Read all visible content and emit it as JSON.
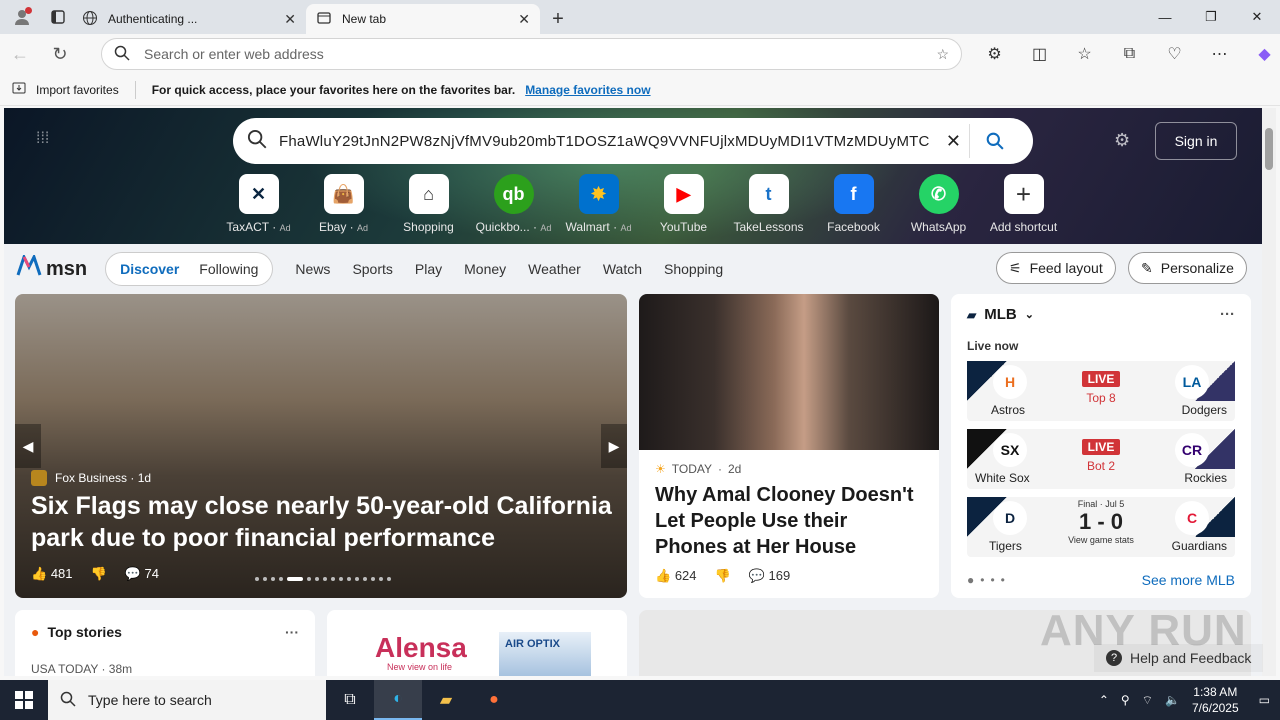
{
  "browser": {
    "tabs": [
      {
        "title": "Authenticating ...",
        "active": false
      },
      {
        "title": "New tab",
        "active": true
      }
    ],
    "address_placeholder": "Search or enter web address",
    "favbar": {
      "import_label": "Import favorites",
      "hint": "For quick access, place your favorites here on the favorites bar.",
      "manage_link": "Manage favorites now"
    }
  },
  "msn": {
    "search_query": "FhaWluY29tJnN2PW8zNjVfMV9ub20mbT1DOSZ1aWQ9VVNFUjlxMDUyMDI1VTMzMDUyMTC",
    "sign_in": "Sign in",
    "shortcuts": [
      {
        "label": "TaxACT",
        "ad": "Ad",
        "color": "#0a2540"
      },
      {
        "label": "Ebay",
        "ad": "Ad",
        "color": "#e53238"
      },
      {
        "label": "Shopping",
        "ad": "",
        "color": "#333"
      },
      {
        "label": "Quickbo...",
        "ad": "Ad",
        "color": "#2ca01c"
      },
      {
        "label": "Walmart",
        "ad": "Ad",
        "color": "#0071ce"
      },
      {
        "label": "YouTube",
        "ad": "",
        "color": "#ff0000"
      },
      {
        "label": "TakeLessons",
        "ad": "",
        "color": "#1a73c9"
      },
      {
        "label": "Facebook",
        "ad": "",
        "color": "#1877f2"
      },
      {
        "label": "WhatsApp",
        "ad": "",
        "color": "#25d366"
      },
      {
        "label": "Add shortcut",
        "ad": "",
        "color": "#555"
      }
    ],
    "logo": "msn",
    "pills": [
      "Discover",
      "Following"
    ],
    "nav": [
      "News",
      "Sports",
      "Play",
      "Money",
      "Weather",
      "Watch",
      "Shopping"
    ],
    "feed_layout": "Feed layout",
    "personalize": "Personalize"
  },
  "main_story": {
    "source": "Fox Business",
    "age": "1d",
    "headline": "Six Flags may close nearly 50-year-old California park due to poor financial performance",
    "likes": "481",
    "comments": "74"
  },
  "side_story": {
    "source": "TODAY",
    "age": "2d",
    "headline": "Why Amal Clooney Doesn't Let People Use their Phones at Her House",
    "likes": "624",
    "comments": "169"
  },
  "mlb": {
    "title": "MLB",
    "live_now": "Live now",
    "games": [
      {
        "home": "Astros",
        "away": "Dodgers",
        "tag": "LIVE",
        "status": "Top 8",
        "hl": "H",
        "al": "LA"
      },
      {
        "home": "White Sox",
        "away": "Rockies",
        "tag": "LIVE",
        "status": "Bot 2",
        "hl": "SX",
        "al": "CR"
      },
      {
        "home": "Tigers",
        "away": "Guardians",
        "final": "Final · Jul 5",
        "score": "1 - 0",
        "view": "View game stats",
        "hl": "D",
        "al": "C"
      }
    ],
    "see_more": "See more MLB"
  },
  "bottom": {
    "top_stories": "Top stories",
    "top_source": "USA TODAY · 38m",
    "ad_brand": "Alensa",
    "ad_tag": "New view on life",
    "ad_product": "AIR OPTIX"
  },
  "help": "Help and Feedback",
  "watermark": "ANY RUN",
  "taskbar": {
    "search_placeholder": "Type here to search",
    "time": "1:38 AM",
    "date": "7/6/2025"
  }
}
